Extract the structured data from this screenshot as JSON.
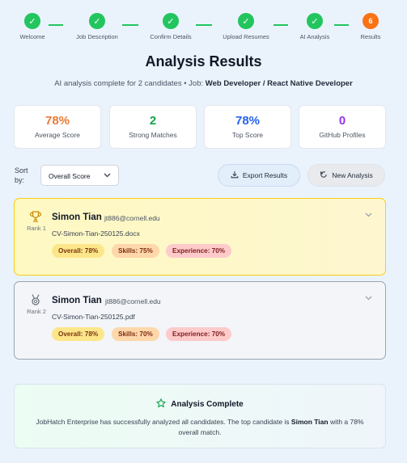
{
  "stepper": {
    "steps": [
      {
        "label": "Welcome",
        "mark": "✓"
      },
      {
        "label": "Job Description",
        "mark": "✓"
      },
      {
        "label": "Confirm Details",
        "mark": "✓"
      },
      {
        "label": "Upload Resumes",
        "mark": "✓"
      },
      {
        "label": "AI Analysis",
        "mark": "✓"
      },
      {
        "label": "Results",
        "mark": "6"
      }
    ]
  },
  "header": {
    "title": "Analysis Results",
    "subtitle_prefix": "AI analysis complete for 2 candidates • Job:",
    "job": "Web Developer / React Native Developer"
  },
  "stats": [
    {
      "value": "78%",
      "label": "Average Score",
      "color": "#ea7a35"
    },
    {
      "value": "2",
      "label": "Strong Matches",
      "color": "#16a34a"
    },
    {
      "value": "78%",
      "label": "Top Score",
      "color": "#2563eb"
    },
    {
      "value": "0",
      "label": "GitHub Profiles",
      "color": "#9333ea"
    }
  ],
  "toolbar": {
    "sort_label": "Sort by:",
    "sort_value": "Overall Score",
    "export_label": "Export Results",
    "new_label": "New Analysis"
  },
  "candidates": [
    {
      "rank": "Rank 1",
      "name": "Simon Tian",
      "email": "jt886@cornell.edu",
      "file": "CV-Simon-Tian-250125.docx",
      "overall": "Overall: 78%",
      "skills": "Skills: 75%",
      "experience": "Experience: 70%"
    },
    {
      "rank": "Rank 2",
      "name": "Simon Tian",
      "email": "jt886@cornell.edu",
      "file": "CV-Simon-Tian-250125.pdf",
      "overall": "Overall: 78%",
      "skills": "Skills: 70%",
      "experience": "Experience: 70%"
    }
  ],
  "complete": {
    "title": "Analysis Complete",
    "msg_prefix": "JobHatch Enterprise has successfully analyzed all candidates. The top candidate is",
    "top_name": "Simon Tian",
    "msg_suffix": "with a 78% overall match."
  },
  "icons": {
    "step_done": "check-icon",
    "rank1": "trophy-icon",
    "rank2": "medal-icon",
    "export": "download-icon",
    "new": "refresh-icon",
    "complete": "star-icon"
  }
}
